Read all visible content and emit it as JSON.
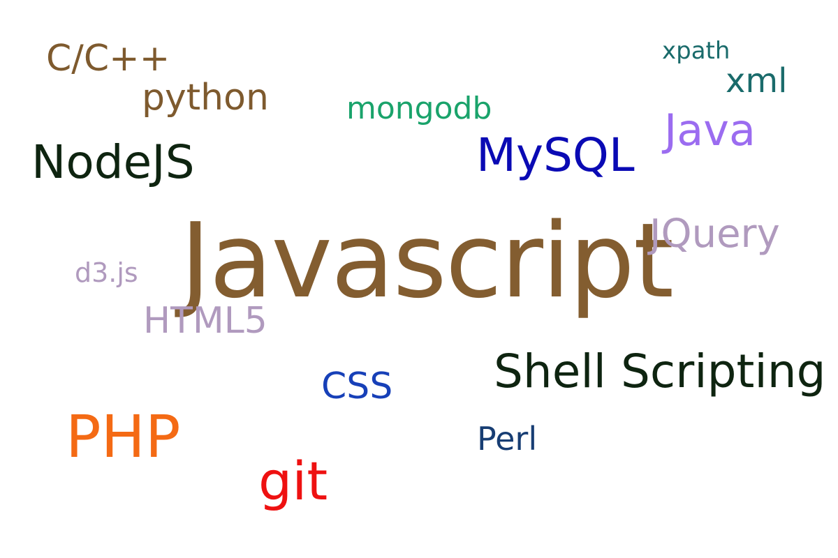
{
  "word_cloud": {
    "background": "#ffffff",
    "words": [
      {
        "key": "cpp",
        "text": "C/C++",
        "color": "#7e5a2e"
      },
      {
        "key": "python",
        "text": "python",
        "color": "#7e5a2e"
      },
      {
        "key": "mongodb",
        "text": "mongodb",
        "color": "#1aa36b"
      },
      {
        "key": "xpath",
        "text": "xpath",
        "color": "#1a6b6b"
      },
      {
        "key": "xml",
        "text": "xml",
        "color": "#1a6b6b"
      },
      {
        "key": "java",
        "text": "Java",
        "color": "#9b6cf0"
      },
      {
        "key": "nodejs",
        "text": "NodeJS",
        "color": "#0e2410"
      },
      {
        "key": "mysql",
        "text": "MySQL",
        "color": "#0a0ab4"
      },
      {
        "key": "js",
        "text": "Javascript",
        "color": "#835d30"
      },
      {
        "key": "jquery",
        "text": "JQuery",
        "color": "#b09abe"
      },
      {
        "key": "d3",
        "text": "d3.js",
        "color": "#b09abe"
      },
      {
        "key": "html5",
        "text": "HTML5",
        "color": "#b09abe"
      },
      {
        "key": "shell",
        "text": "Shell Scripting",
        "color": "#0e2410"
      },
      {
        "key": "css",
        "text": "CSS",
        "color": "#1740b8"
      },
      {
        "key": "php",
        "text": "PHP",
        "color": "#f46a14"
      },
      {
        "key": "perl",
        "text": "Perl",
        "color": "#173d73"
      },
      {
        "key": "git",
        "text": "git",
        "color": "#ee1111"
      }
    ]
  }
}
